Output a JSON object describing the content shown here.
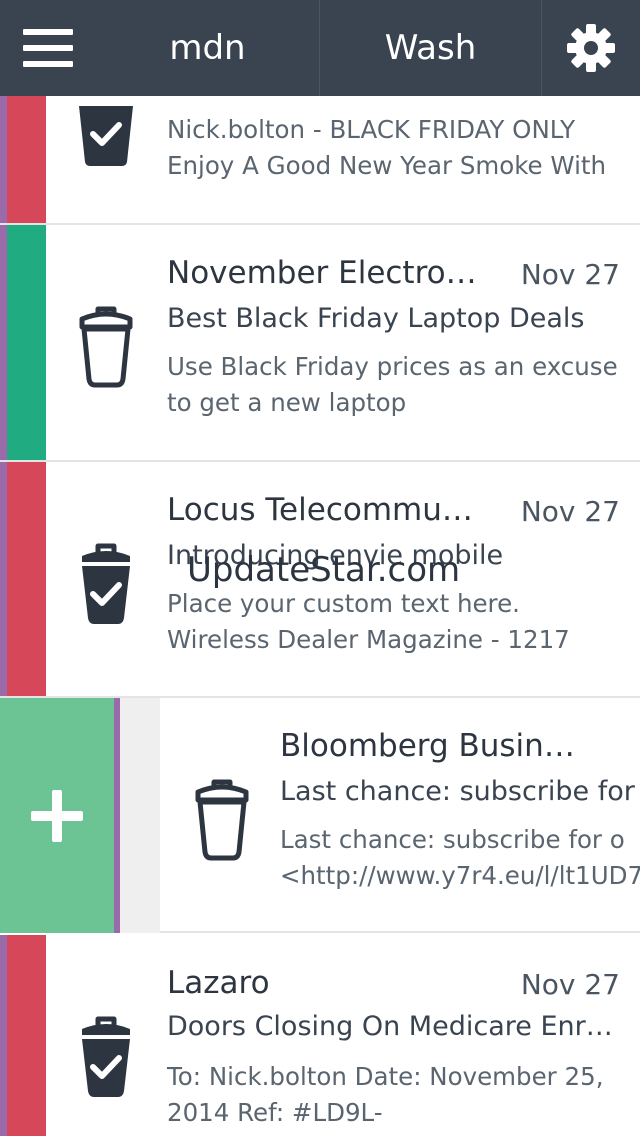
{
  "nav": {
    "tabs": [
      {
        "label": "mdn"
      },
      {
        "label": "Wash"
      }
    ],
    "menu_icon": "hamburger-menu-icon",
    "settings_icon": "gear-icon"
  },
  "colors": {
    "topbar": "#3a4450",
    "red_label": "#d6475a",
    "green_label": "#21ab80",
    "purple_stripe": "#9b6aa8",
    "add_panel": "#6cc494"
  },
  "emails": [
    {
      "sender": "",
      "date": "",
      "subject": "",
      "preview": "Nick.bolton - BLACK FRIDAY ONLY Enjoy A Good New Year Smoke With",
      "icon": "checked-trash-icon",
      "label_color": "red"
    },
    {
      "sender": "November Electro…",
      "date": "Nov 27",
      "subject": "Best Black Friday Laptop Deals",
      "preview": "Use Black Friday prices as an excuse to get a new laptop",
      "icon": "empty-trash-icon",
      "label_color": "green"
    },
    {
      "sender": "Locus Telecommu…",
      "date": "Nov 27",
      "subject": "Introducing envie mobile",
      "preview": "Place your custom text here. Wireless Dealer Magazine - 1217",
      "icon": "checked-trash-icon",
      "label_color": "red"
    },
    {
      "sender": "Bloomberg Busin…",
      "date": "",
      "subject": "Last chance: subscribe for",
      "preview": "Last chance: subscribe for o <http://www.y7r4.eu/l/lt1UD7",
      "icon": "empty-trash-icon",
      "label_color": "none"
    },
    {
      "sender": "Lazaro",
      "date": "Nov 27",
      "subject": "Doors Closing On Medicare Enr…",
      "preview": "To: Nick.bolton Date: November 25, 2014 Ref: #LD9L-",
      "icon": "checked-trash-icon",
      "label_color": "red"
    }
  ],
  "swipe_action": {
    "icon": "plus-icon"
  },
  "watermark": "UpdateStar.com"
}
